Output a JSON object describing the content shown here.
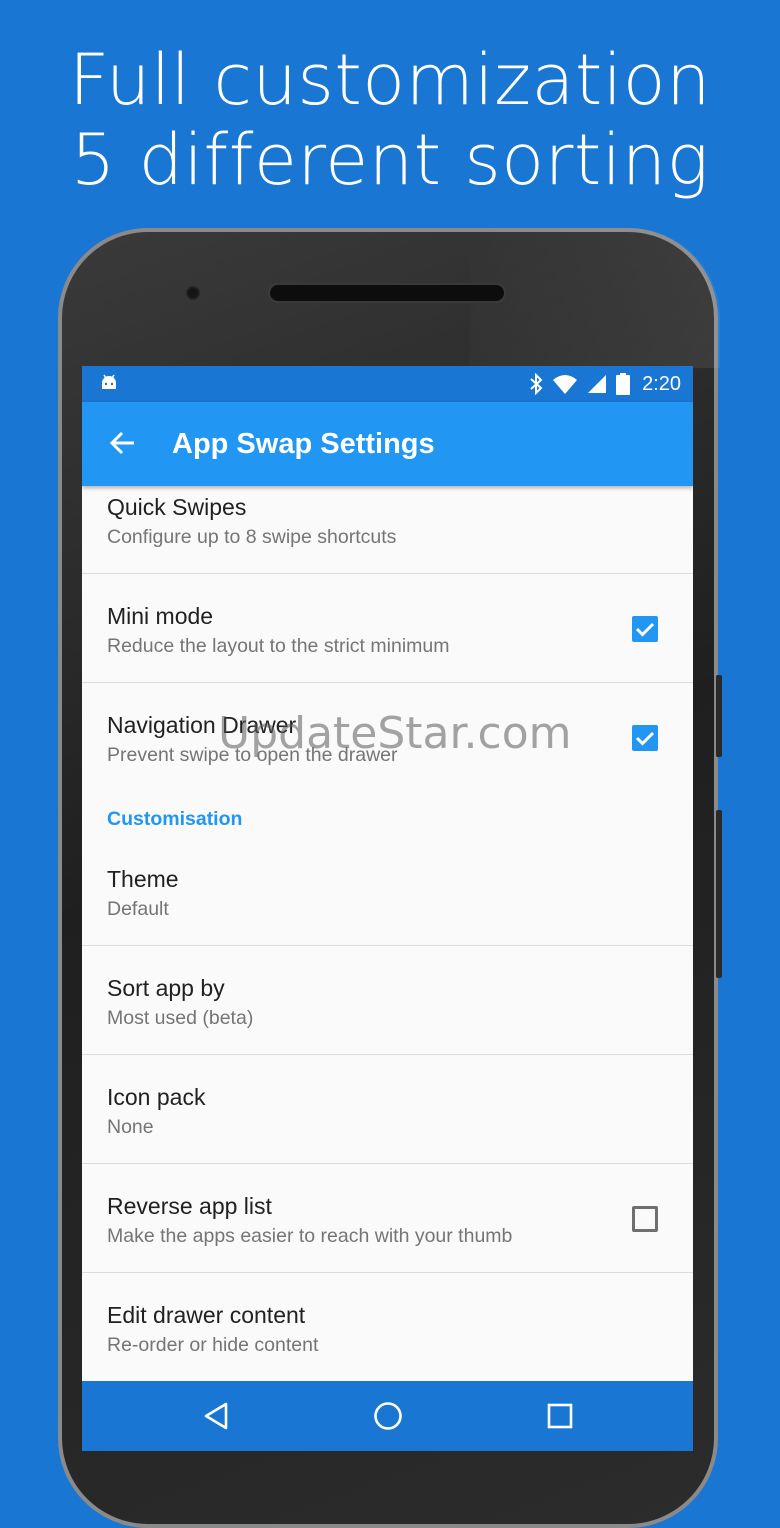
{
  "promo": {
    "line1": "Full customization",
    "line2": "5 different sorting"
  },
  "status_bar": {
    "time": "2:20",
    "icons": [
      "android-icon",
      "bluetooth-icon",
      "wifi-icon",
      "signal-icon",
      "battery-icon"
    ]
  },
  "app_bar": {
    "back_icon": "arrow-left-icon",
    "title": "App Swap Settings"
  },
  "preferences": [
    {
      "title": "Quick Swipes",
      "subtitle": "Configure up to 8 swipe shortcuts"
    },
    {
      "title": "Mini mode",
      "subtitle": "Reduce the layout to the strict minimum",
      "checked": true
    },
    {
      "title": "Navigation Drawer",
      "subtitle": "Prevent swipe to open the drawer",
      "checked": true
    }
  ],
  "section": {
    "label": "Customisation",
    "items": [
      {
        "title": "Theme",
        "subtitle": "Default"
      },
      {
        "title": "Sort app by",
        "subtitle": "Most used (beta)"
      },
      {
        "title": "Icon pack",
        "subtitle": "None"
      },
      {
        "title": "Reverse app list",
        "subtitle": "Make the apps easier to reach with your thumb",
        "checked": false
      },
      {
        "title": "Edit drawer content",
        "subtitle": "Re-order or hide content"
      }
    ]
  },
  "nav_bar": {
    "icons": [
      "back-triangle-icon",
      "home-circle-icon",
      "recents-square-icon"
    ]
  },
  "watermark": "UpdateStar.com",
  "colors": {
    "background": "#1976d2",
    "app_bar": "#2196f3",
    "accent": "#2196f3"
  }
}
